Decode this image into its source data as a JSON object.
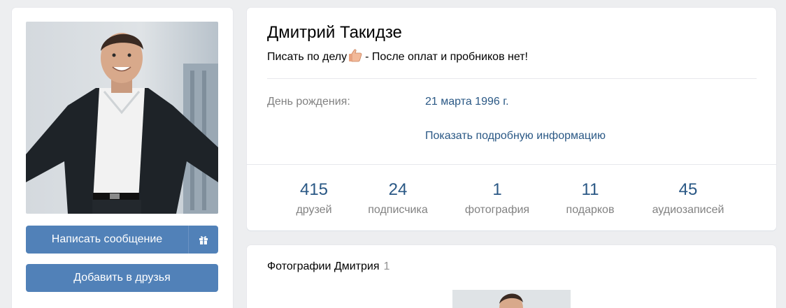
{
  "profile": {
    "name": "Дмитрий Такидзе",
    "status_text_before": "Писать по делу",
    "status_text_after": " - После оплат и пробников нет!",
    "status_emoji": "thumbs-up-icon"
  },
  "info": {
    "birthday_label": "День рождения:",
    "birthday_value": "21 марта 1996 г.",
    "show_more": "Показать подробную информацию"
  },
  "counters": [
    {
      "value": "415",
      "label": "друзей"
    },
    {
      "value": "24",
      "label": "подписчика"
    },
    {
      "value": "1",
      "label": "фотография"
    },
    {
      "value": "11",
      "label": "подарков"
    },
    {
      "value": "45",
      "label": "аудиозаписей"
    }
  ],
  "actions": {
    "message_label": "Написать сообщение",
    "gift_icon": "gift-icon",
    "add_friend_label": "Добавить в друзья"
  },
  "photos": {
    "title": "Фотографии Дмитрия",
    "count": "1"
  },
  "colors": {
    "background": "#edeef0",
    "button": "#5181b8",
    "link": "#2a5885",
    "muted": "#828282"
  }
}
